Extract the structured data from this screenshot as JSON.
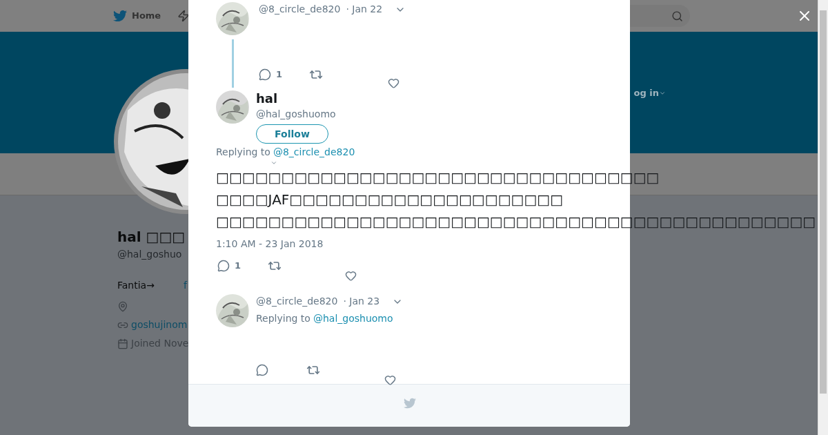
{
  "nav": {
    "home": "Home",
    "login": "og in"
  },
  "profile": {
    "name": "hal □□□",
    "handle": "@hal_goshuo",
    "bio_text": "Fantia→",
    "bio_link": "f",
    "website": "goshujinom",
    "joined": "Joined Nove"
  },
  "modal": {
    "parent": {
      "handle": "@8_circle_de820",
      "time": "· Jan 22",
      "reply_count": "1"
    },
    "main": {
      "name": "hal",
      "handle": "@hal_goshuomo",
      "follow": "Follow",
      "replying_label": "Replying to",
      "replying_to": "@8_circle_de820",
      "lines": [
        "□□□□□□□□□□□□□□□□□□□□□□□□□□□□□□□□□□",
        "□□□□JAF□□□□□□□□□□□□□□□□□□□□□",
        "□□□□□□□□□□□□□□□□□□□□□□□□□□□□□□□□□□□□□□□□□□□□□□"
      ],
      "timestamp": "1:10 AM - 23 Jan 2018",
      "reply_count": "1"
    },
    "reply": {
      "handle": "@8_circle_de820",
      "time": "· Jan 23",
      "replying_label": "Replying to",
      "replying_to": "@hal_goshuomo"
    }
  }
}
